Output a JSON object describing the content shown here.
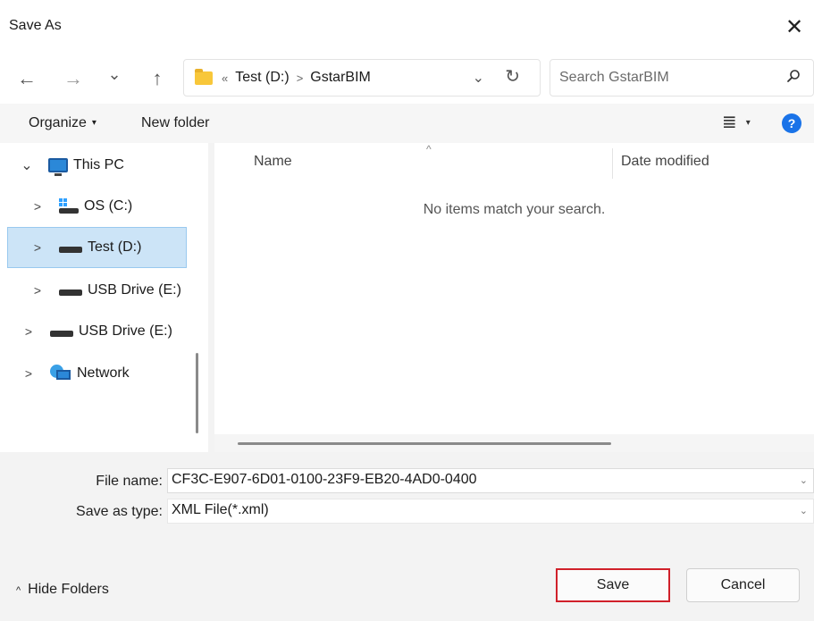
{
  "window": {
    "title": "Save As",
    "close_glyph": "✕"
  },
  "nav": {
    "back_glyph": "←",
    "forward_glyph": "→",
    "recent_glyph": "⌄",
    "up_glyph": "↑",
    "breadcrumb_overflow": "«",
    "breadcrumb": [
      "Test (D:)",
      "GstarBIM"
    ],
    "breadcrumb_sep": ">",
    "address_dropdown_glyph": "⌄",
    "refresh_glyph": "↻",
    "search_placeholder": "Search GstarBIM"
  },
  "toolbar": {
    "organize_label": "Organize",
    "caret": "▾",
    "new_folder_label": "New folder",
    "view_glyph": "≣",
    "help_glyph": "?"
  },
  "sidebar": {
    "items": [
      {
        "label": "This PC",
        "chevron": "⌄",
        "icon": "computer-icon"
      },
      {
        "label": "OS (C:)",
        "chevron": ">",
        "icon": "os-drive-icon"
      },
      {
        "label": "Test (D:)",
        "chevron": ">",
        "icon": "drive-icon",
        "selected": true
      },
      {
        "label": "USB Drive (E:)",
        "chevron": ">",
        "icon": "drive-icon"
      },
      {
        "label": "USB Drive (E:)",
        "chevron": ">",
        "icon": "drive-icon"
      },
      {
        "label": "Network",
        "chevron": ">",
        "icon": "network-icon"
      }
    ]
  },
  "files": {
    "sort_caret": "^",
    "columns": [
      "Name",
      "Date modified"
    ],
    "empty_message": "No items match your search."
  },
  "form": {
    "file_name_label": "File name:",
    "file_name_value": "CF3C-E907-6D01-0100-23F9-EB20-4AD0-0400",
    "save_type_label": "Save as type:",
    "save_type_value": "XML File(*.xml)",
    "dropdown_glyph": "⌄"
  },
  "footer": {
    "hide_folders_caret": "^",
    "hide_folders_label": "Hide Folders",
    "save_label": "Save",
    "cancel_label": "Cancel"
  },
  "colors": {
    "accent": "#1a73e8",
    "selection": "#cce4f7",
    "highlight_border": "#d0202a",
    "folder": "#f8c73a"
  }
}
